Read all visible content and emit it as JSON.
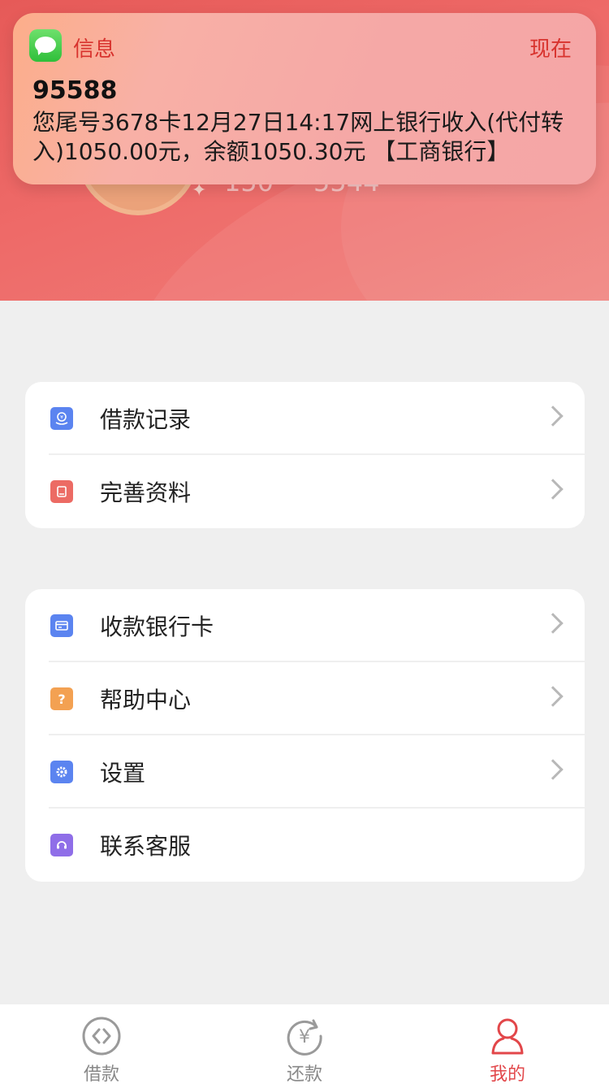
{
  "notification": {
    "app_name": "信息",
    "time": "现在",
    "sender": "95588",
    "message": "您尾号3678卡12月27日14:17网上银行收入(代付转入)1050.00元，余额1050.30元 【工商银行】",
    "app_icon": "messages-icon"
  },
  "header": {
    "stat_left": "150",
    "stat_right": "5544"
  },
  "menu_group_1": [
    {
      "label": "借款记录",
      "icon": "loan-record-icon",
      "color": "#5b84f0"
    },
    {
      "label": "完善资料",
      "icon": "profile-book-icon",
      "color": "#ec6b64"
    }
  ],
  "menu_group_2": [
    {
      "label": "收款银行卡",
      "icon": "bank-card-icon",
      "color": "#5b84f0"
    },
    {
      "label": "帮助中心",
      "icon": "help-icon",
      "color": "#f3a152"
    },
    {
      "label": "设置",
      "icon": "settings-gear-icon",
      "color": "#5b84f0"
    },
    {
      "label": "联系客服",
      "icon": "customer-service-icon",
      "color": "#8f6ee8"
    }
  ],
  "tabs": [
    {
      "label": "借款",
      "icon": "borrow-icon"
    },
    {
      "label": "还款",
      "icon": "repay-icon"
    },
    {
      "label": "我的",
      "icon": "profile-icon",
      "active": true
    }
  ],
  "colors": {
    "header_red": "#ee6a68",
    "accent": "#e2474a",
    "notification_bg": "#f5a6a6"
  }
}
